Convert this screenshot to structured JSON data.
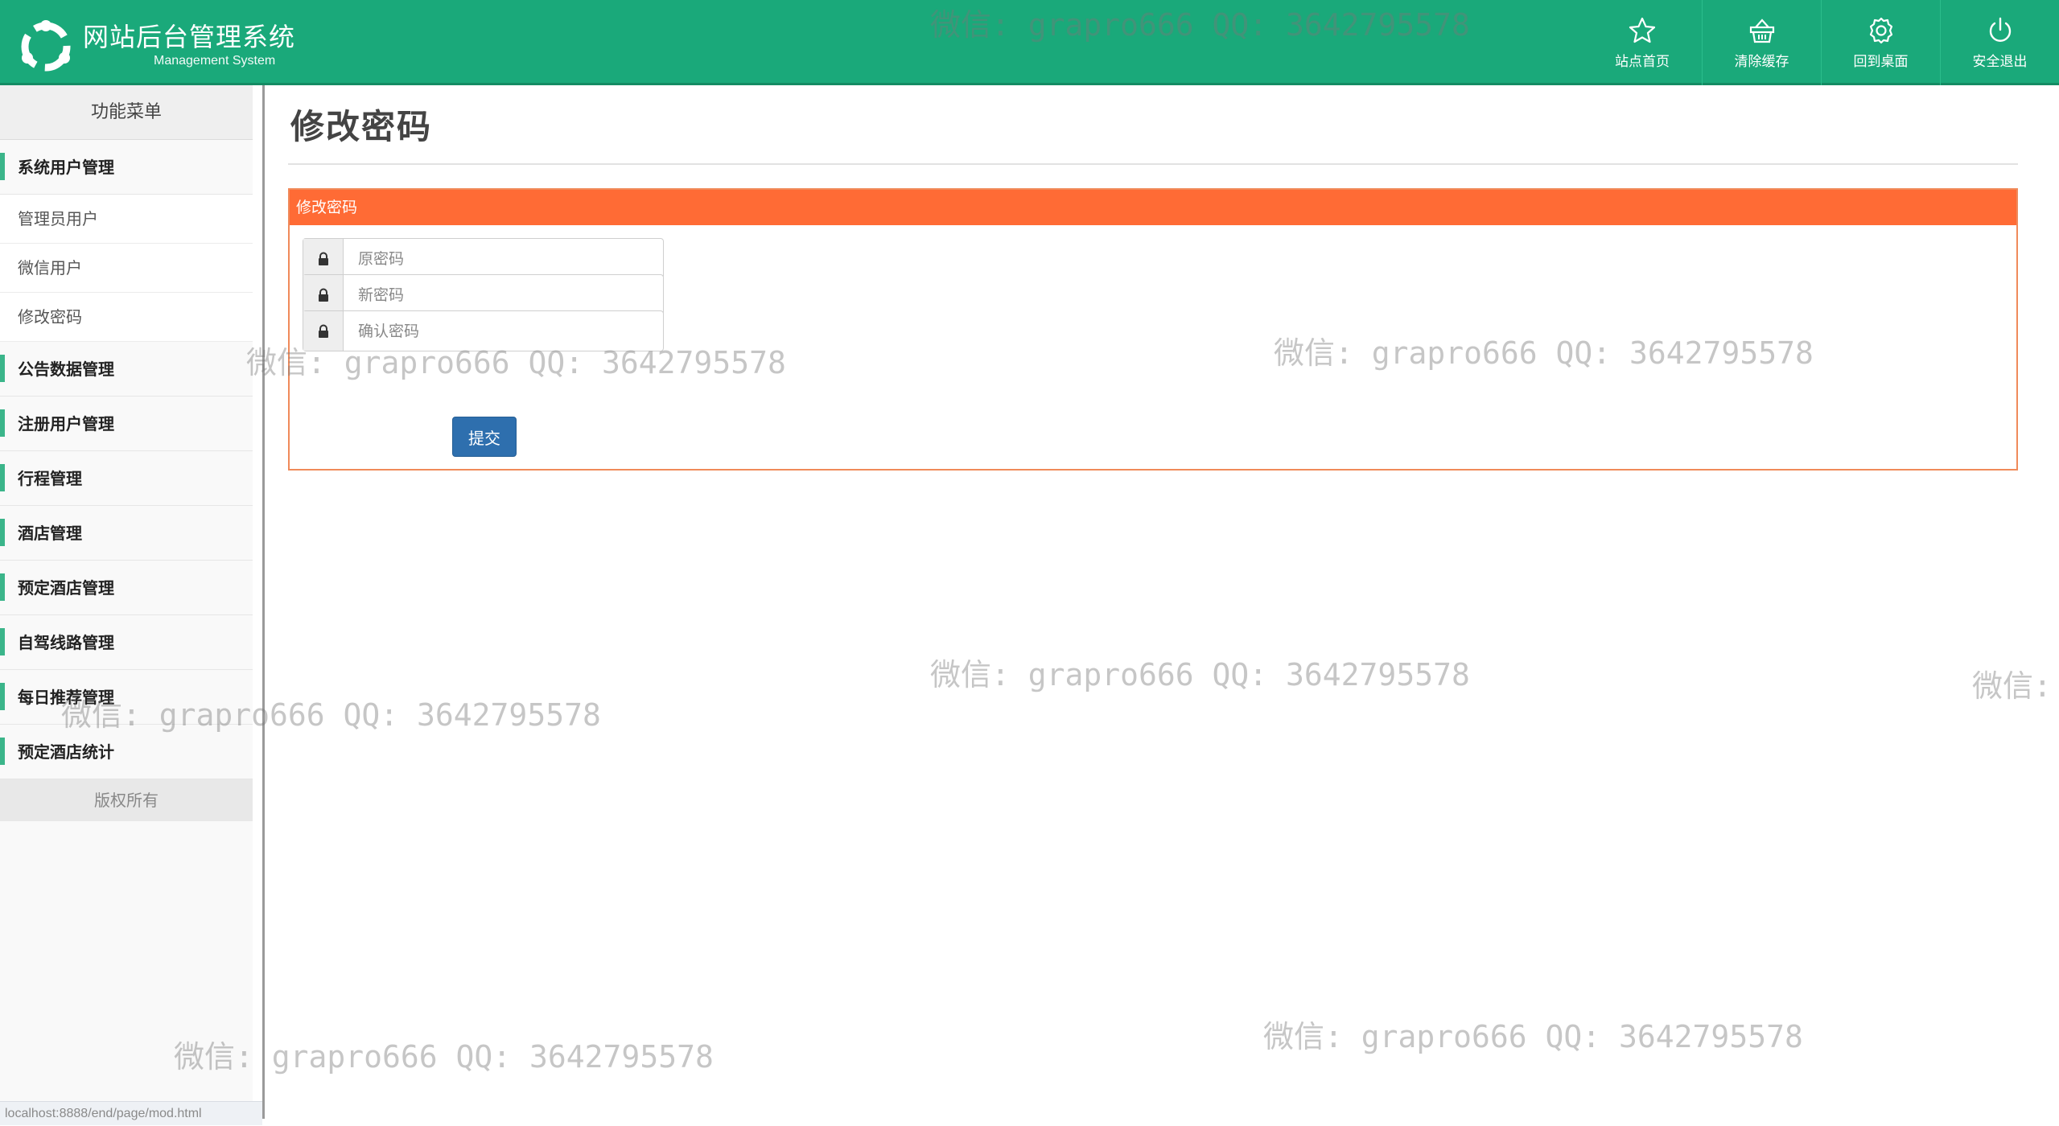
{
  "header": {
    "title": "网站后台管理系统",
    "subtitle": "Management System",
    "nav": [
      {
        "label": "站点首页",
        "icon": "star-icon"
      },
      {
        "label": "清除缓存",
        "icon": "basket-icon"
      },
      {
        "label": "回到桌面",
        "icon": "gear-icon"
      },
      {
        "label": "安全退出",
        "icon": "power-icon"
      }
    ]
  },
  "sidebar": {
    "title": "功能菜单",
    "groups": [
      {
        "label": "系统用户管理",
        "items": [
          "管理员用户",
          "微信用户",
          "修改密码"
        ]
      },
      {
        "label": "公告数据管理"
      },
      {
        "label": "注册用户管理"
      },
      {
        "label": "行程管理"
      },
      {
        "label": "酒店管理"
      },
      {
        "label": "预定酒店管理"
      },
      {
        "label": "自驾线路管理"
      },
      {
        "label": "每日推荐管理"
      },
      {
        "label": "预定酒店统计"
      }
    ],
    "copyright": "版权所有"
  },
  "main": {
    "page_title": "修改密码",
    "panel_title": "修改密码",
    "fields": [
      {
        "placeholder": "原密码",
        "value": ""
      },
      {
        "placeholder": "新密码",
        "value": ""
      },
      {
        "placeholder": "确认密码",
        "value": ""
      }
    ],
    "submit_label": "提交"
  },
  "status_url": "localhost:8888/end/page/mod.html",
  "watermark_text": "微信: grapro666 QQ: 3642795578",
  "watermark_partial": "微信:",
  "colors": {
    "header": "#1aa97a",
    "panel_head": "#ff6b35",
    "button": "#2e6fae"
  }
}
